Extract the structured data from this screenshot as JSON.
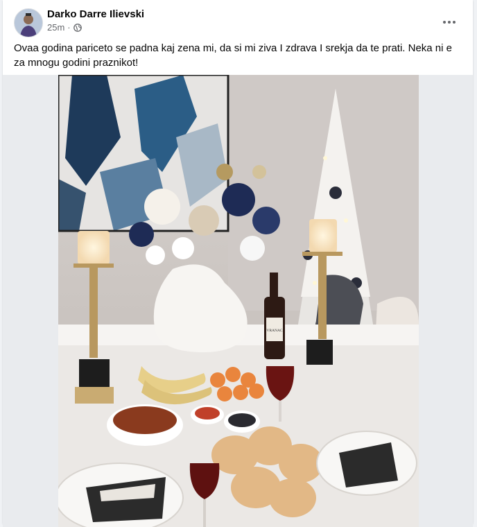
{
  "post": {
    "author": "Darko Darre Ilievski",
    "time": "25m",
    "dot": "·",
    "audience_icon": "globe-icon",
    "menu_icon": "more-options-icon",
    "text": "Ovaa godina pariceto se padna kaj zena mi, da si mi ziva I zdrava I srekja da te prati. Neka ni e za mnogu godini praznikot!"
  },
  "photo": {
    "subject": "holiday-table-photo",
    "bottle_label": "VRANAC"
  },
  "colors": {
    "card": "#ffffff",
    "page_bg": "#f0f2f5",
    "primary_text": "#050505",
    "secondary_text": "#65676b"
  }
}
